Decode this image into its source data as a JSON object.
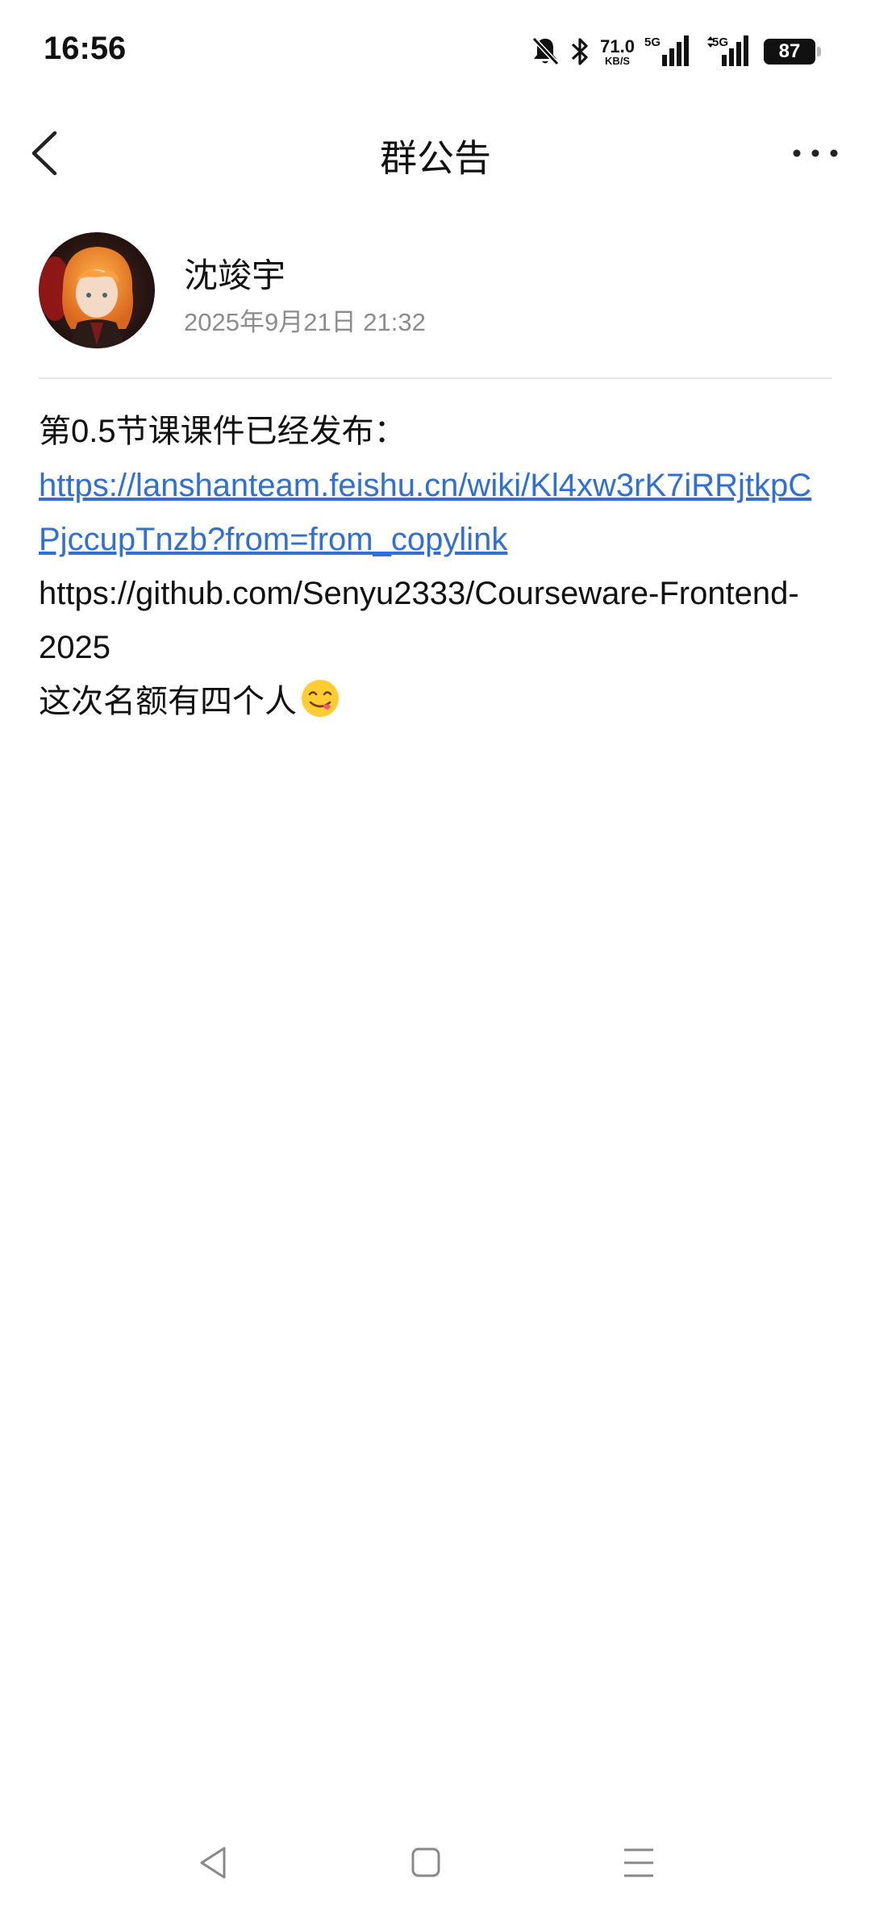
{
  "status_bar": {
    "time": "16:56",
    "net_speed_value": "71.0",
    "net_speed_unit": "KB/S",
    "sim1_tag": "5G",
    "sim2_tag": "5G",
    "battery": "87",
    "icons": [
      "bell-off-icon",
      "bluetooth-icon",
      "signal-icon",
      "signal-icon",
      "battery-icon"
    ]
  },
  "header": {
    "title": "群公告",
    "back_icon": "chevron-left-icon",
    "more_icon": "more-icon"
  },
  "post": {
    "author": "沈竣宇",
    "time": "2025年9月21日 21:32",
    "line1": "第0.5节课课件已经发布：",
    "link": "https://lanshanteam.feishu.cn/wiki/Kl4xw3rK7iRRjtkpCPjccupTnzb?from=from_copylink",
    "github": "https://github.com/Senyu2333/Courseware-Frontend-2025",
    "note": "这次名额有四个人",
    "emoji": "😋"
  },
  "colors": {
    "link": "#2f6fd6",
    "secondary_text": "#8c8c8c",
    "divider": "#e6e6e6"
  },
  "navbar": {
    "icons": [
      "back-triangle-icon",
      "home-square-icon",
      "menu-lines-icon"
    ]
  }
}
